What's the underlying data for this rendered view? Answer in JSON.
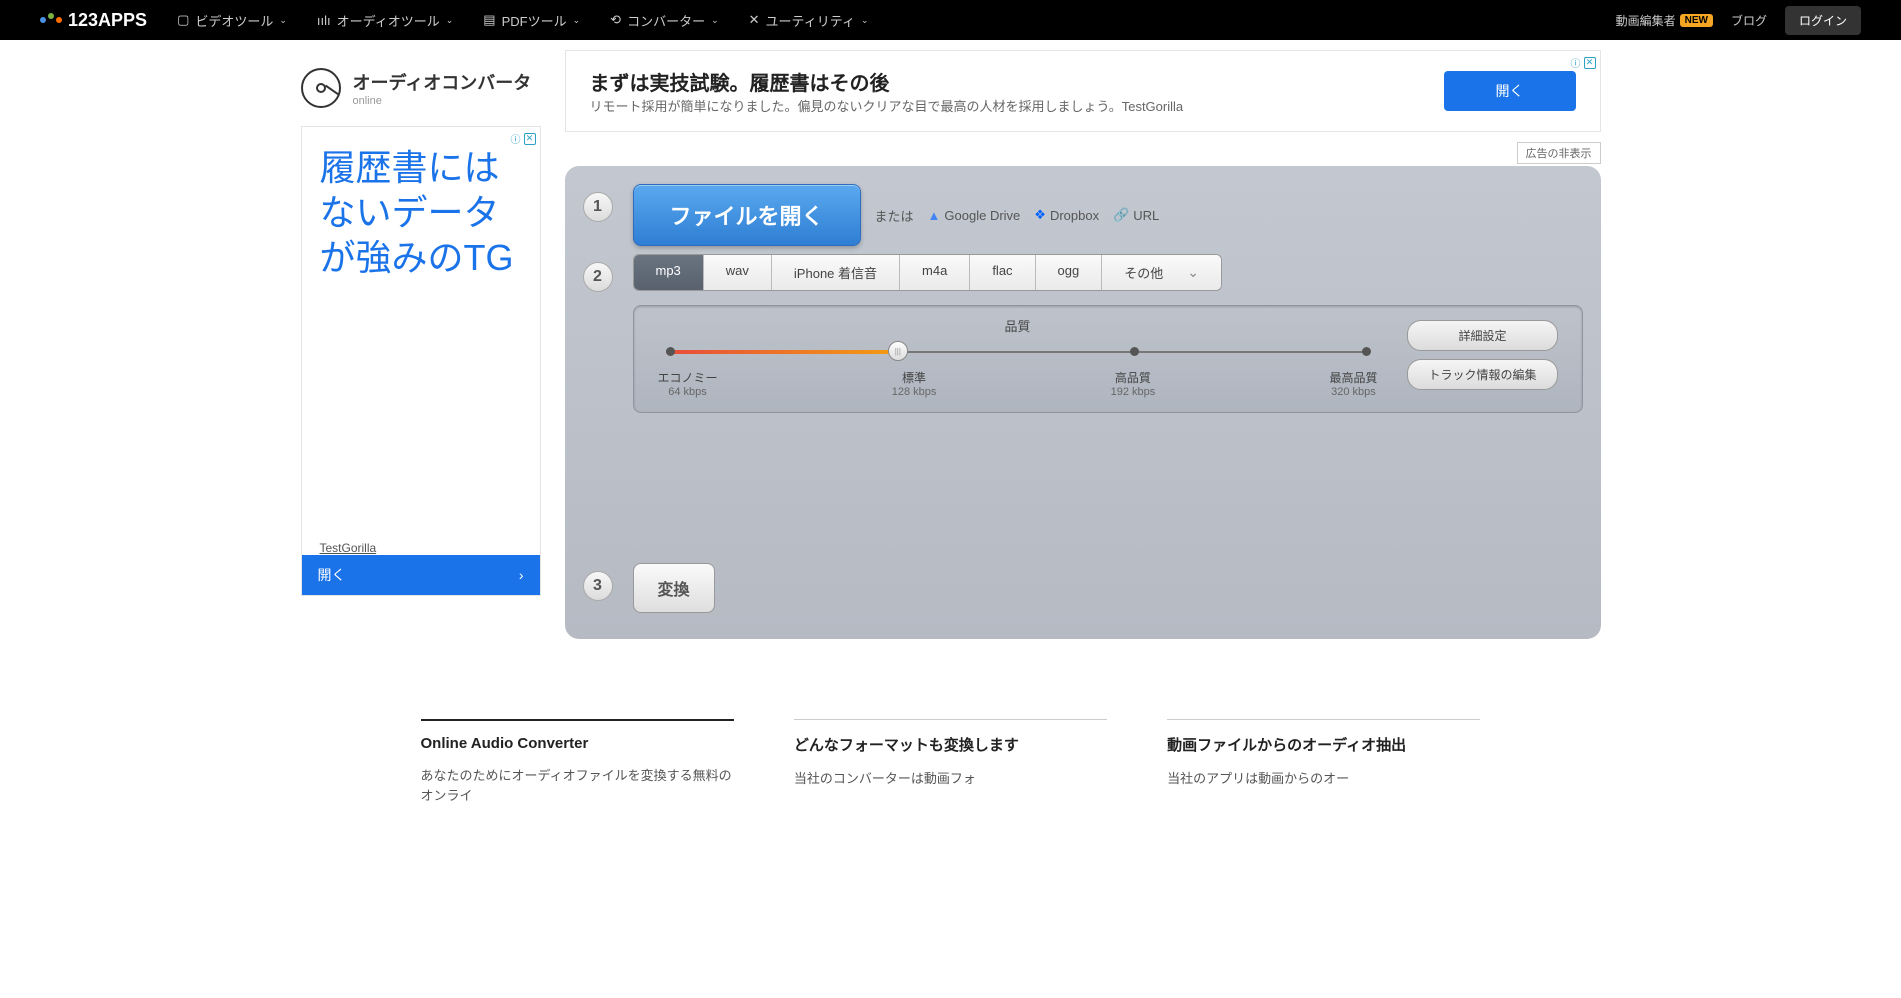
{
  "nav": {
    "logo": "123APPS",
    "items": [
      "ビデオツール",
      "オーディオツール",
      "PDFツール",
      "コンバーター",
      "ユーティリティ"
    ],
    "editor": "動画編集者",
    "new_badge": "NEW",
    "blog": "ブログ",
    "login": "ログイン"
  },
  "brand": {
    "title": "オーディオコンバータ",
    "sub": "online"
  },
  "ad_top": {
    "title": "まずは実技試験。履歴書はその後",
    "desc": "リモート採用が簡単になりました。偏見のないクリアな目で最高の人材を採用しましょう。TestGorilla",
    "btn": "開く",
    "info": "ⓘ"
  },
  "ad_hide": "広告の非表示",
  "ad_side": {
    "text": "履歴書にはないデータが強みのTG",
    "brand": "TestGorilla",
    "btn": "開く",
    "bg": "Test\nGorilla"
  },
  "step1": {
    "open": "ファイルを開く",
    "or": "または",
    "gdrive": "Google Drive",
    "dropbox": "Dropbox",
    "url": "URL"
  },
  "step2": {
    "formats": [
      "mp3",
      "wav",
      "iPhone 着信音",
      "m4a",
      "flac",
      "ogg",
      "その他"
    ],
    "quality_label": "品質",
    "steps": [
      {
        "label": "エコノミー",
        "kbps": "64 kbps"
      },
      {
        "label": "標準",
        "kbps": "128 kbps"
      },
      {
        "label": "高品質",
        "kbps": "192 kbps"
      },
      {
        "label": "最高品質",
        "kbps": "320 kbps"
      }
    ],
    "advanced": "詳細設定",
    "tracks": "トラック情報の編集"
  },
  "step3": {
    "convert": "変換"
  },
  "info": {
    "col1_title": "Online Audio Converter",
    "col1_text": "あなたのためにオーディオファイルを変換する無料のオンライ",
    "col2_title": "どんなフォーマットも変換します",
    "col2_text": "当社のコンバーターは動画フォ",
    "col3_title": "動画ファイルからのオーディオ抽出",
    "col3_text": "当社のアプリは動画からのオー"
  }
}
